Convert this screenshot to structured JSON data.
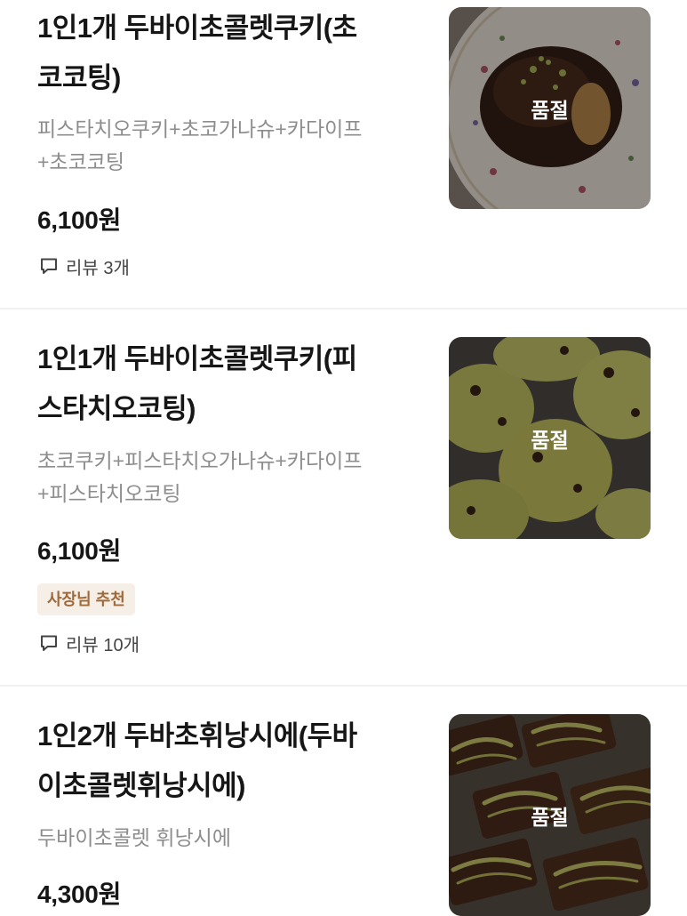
{
  "menu_items": [
    {
      "title_line1": "1인1개 두바이초콜렛쿠키(초",
      "title_line2": "코코팅)",
      "desc_line1": "피스타치오쿠키+초코가나슈+카다이프",
      "desc_line2": "+초코코팅",
      "price": "6,100원",
      "review_label": "리뷰 3개",
      "status_overlay": "품절",
      "image": "chocolate-coated-cookie-on-floral-plate"
    },
    {
      "title_line1": "1인1개 두바이초콜렛쿠키(피",
      "title_line2": "스타치오코팅)",
      "desc_line1": "초코쿠키+피스타치오가나슈+카다이프",
      "desc_line2": "+피스타치오코팅",
      "price": "6,100원",
      "badge": "사장님 추천",
      "review_label": "리뷰 10개",
      "status_overlay": "품절",
      "image": "pistachio-coated-cookies"
    },
    {
      "title_line1": "1인2개 두바초휘낭시에(두바",
      "title_line2": "이초콜렛휘낭시에)",
      "desc_line1": "두바이초콜렛 휘낭시에",
      "price": "4,300원",
      "status_overlay": "품절",
      "image": "chocolate-financiers-with-pistachio-drizzle"
    }
  ],
  "colors": {
    "badge_bg": "#f5efe8",
    "badge_text": "#a0693a",
    "description_text": "#8d8d8d",
    "divider": "#f1f1f1"
  },
  "icons": {
    "review": "speech-bubble-icon"
  }
}
